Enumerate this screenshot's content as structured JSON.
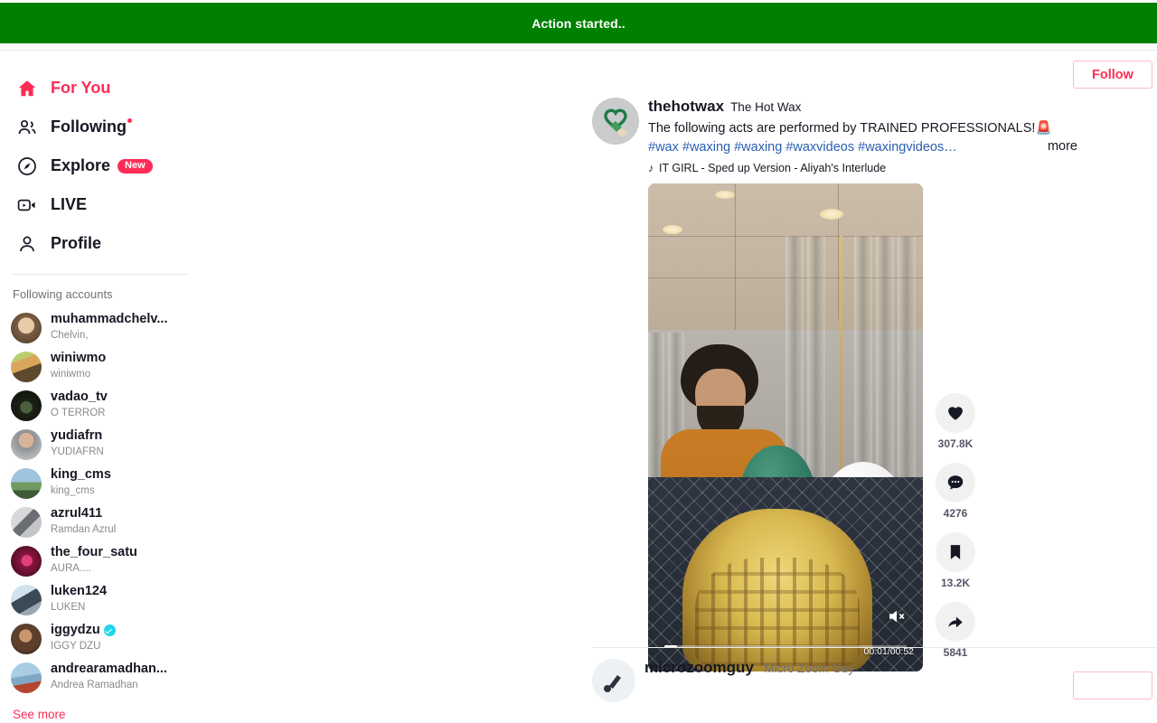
{
  "banner": {
    "text": "Action started.."
  },
  "sidebar": {
    "nav": [
      {
        "label": "For You",
        "icon": "home-icon",
        "active": true,
        "badge": ""
      },
      {
        "label": "Following",
        "icon": "following-people-icon",
        "active": false,
        "badge": "dot"
      },
      {
        "label": "Explore",
        "icon": "compass-icon",
        "active": false,
        "badge": "New"
      },
      {
        "label": "LIVE",
        "icon": "live-video-icon",
        "active": false,
        "badge": ""
      },
      {
        "label": "Profile",
        "icon": "person-icon",
        "active": false,
        "badge": ""
      }
    ],
    "section_title": "Following accounts",
    "accounts": [
      {
        "name": "muhammadchelv...",
        "sub": "Chelvin,",
        "verified": false
      },
      {
        "name": "winiwmo",
        "sub": "winiwmo",
        "verified": false
      },
      {
        "name": "vadao_tv",
        "sub": "O TERROR",
        "verified": false
      },
      {
        "name": "yudiafrn",
        "sub": "YUDIAFRN",
        "verified": false
      },
      {
        "name": "king_cms",
        "sub": "king_cms",
        "verified": false
      },
      {
        "name": "azrul411",
        "sub": "Ramdan Azrul",
        "verified": false
      },
      {
        "name": "the_four_satu",
        "sub": "AURA....",
        "verified": false
      },
      {
        "name": "luken124",
        "sub": "LUKEN",
        "verified": false
      },
      {
        "name": "iggydzu",
        "sub": "IGGY DZU",
        "verified": true
      },
      {
        "name": "andrearamadhan...",
        "sub": "Andrea Ramadhan",
        "verified": false
      }
    ],
    "see_more": "See more"
  },
  "post": {
    "username": "thehotwax",
    "display_name": "The Hot Wax",
    "caption_line1": "The following acts are performed by TRAINED PROFESSIONALS!🚨",
    "caption_tags": "#wax #waxing #waxing #waxvideos #waxingvideos…",
    "more_label": "more",
    "music_note": "♪",
    "music": "IT GIRL - Sped up Version - Aliyah's Interlude",
    "follow_label": "Follow",
    "video": {
      "time": "00:01/00:52",
      "muted": true
    },
    "actions": [
      {
        "icon": "heart-icon",
        "count": "307.8K"
      },
      {
        "icon": "comment-icon",
        "count": "4276"
      },
      {
        "icon": "bookmark-icon",
        "count": "13.2K"
      },
      {
        "icon": "share-icon",
        "count": "5841"
      }
    ]
  },
  "next_post": {
    "username": "microzoomguy",
    "display_name": "Micro Zoom Guy"
  },
  "colors": {
    "accent": "#fe2c55",
    "banner_bg": "#008000",
    "link": "#2b5eb2",
    "verified": "#20d5ec"
  }
}
